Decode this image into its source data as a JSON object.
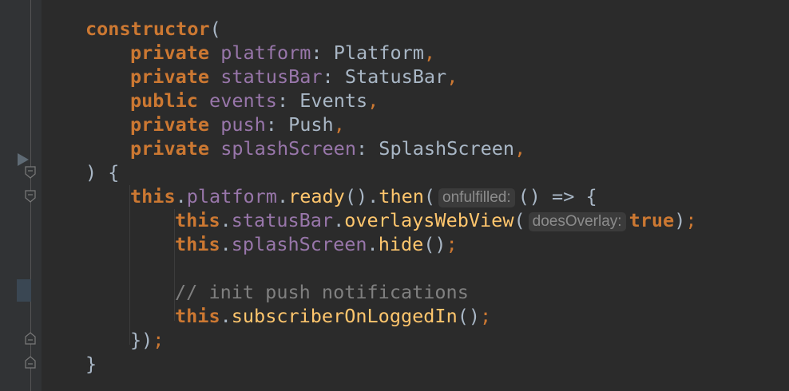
{
  "code": {
    "l1_constructor": "constructor",
    "l1_open": "(",
    "params": [
      {
        "modifier": "private",
        "name": "platform",
        "colon": ":",
        "type": "Platform",
        "comma": ","
      },
      {
        "modifier": "private",
        "name": "statusBar",
        "colon": ":",
        "type": "StatusBar",
        "comma": ","
      },
      {
        "modifier": "public",
        "name": "events",
        "colon": ":",
        "type": "Events",
        "comma": ","
      },
      {
        "modifier": "private",
        "name": "push",
        "colon": ":",
        "type": "Push",
        "comma": ","
      },
      {
        "modifier": "private",
        "name": "splashScreen",
        "colon": ":",
        "type": "SplashScreen",
        "comma": ","
      }
    ],
    "l7_close": ") {",
    "l8": {
      "this": "this",
      "dot1": ".",
      "platform": "platform",
      "dot2": ".",
      "ready": "ready",
      "call1": "().",
      "then": "then",
      "open": "(",
      "hint": "onfulfilled:",
      "arrow": "() => {"
    },
    "l9": {
      "this": "this",
      "dot1": ".",
      "statusBar": "statusBar",
      "dot2": ".",
      "method": "overlaysWebView",
      "open": "(",
      "hint": "doesOverlay:",
      "value": "true",
      "close": ")",
      "semi": ";"
    },
    "l10": {
      "this": "this",
      "dot1": ".",
      "splashScreen": "splashScreen",
      "dot2": ".",
      "method": "hide",
      "call": "()",
      "semi": ";"
    },
    "l12_comment": "// init push notifications",
    "l13": {
      "this": "this",
      "dot": ".",
      "method": "subscriberOnLoggedIn",
      "call": "()",
      "semi": ";"
    },
    "l14": {
      "close": "})",
      "semi": ";"
    },
    "l15_close": "}"
  }
}
